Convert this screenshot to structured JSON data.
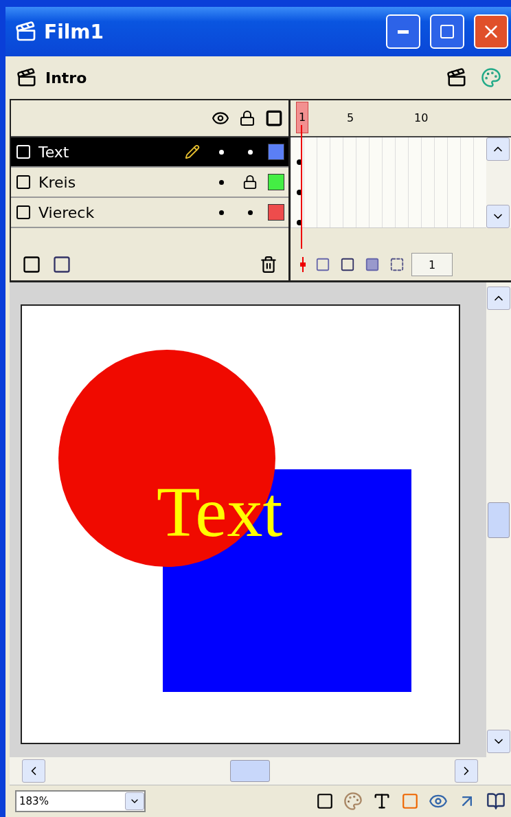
{
  "window": {
    "title": "Film1"
  },
  "scene": {
    "name": "Intro"
  },
  "layers": [
    {
      "name": "Text",
      "selected": true,
      "locked": false,
      "color": "#5b7ff5"
    },
    {
      "name": "Kreis",
      "selected": false,
      "locked": true,
      "color": "#44ee44"
    },
    {
      "name": "Viereck",
      "selected": false,
      "locked": false,
      "color": "#ee4c4c"
    }
  ],
  "ruler": [
    "1",
    "5",
    "10"
  ],
  "current_frame": "1",
  "stage": {
    "text": "Text"
  },
  "zoom": "183%"
}
